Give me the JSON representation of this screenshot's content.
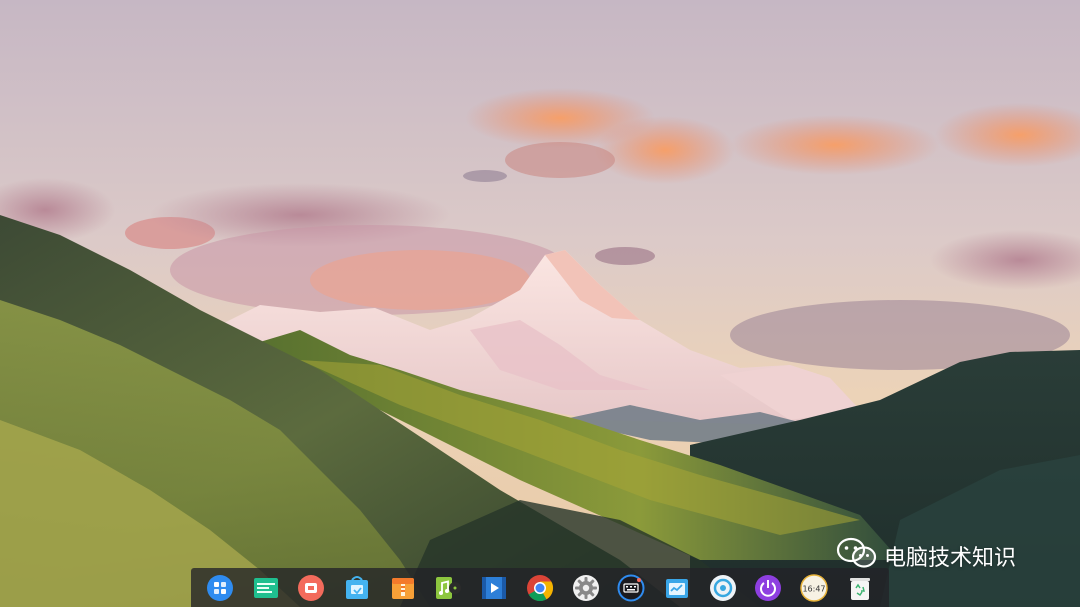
{
  "desktop": {
    "wallpaper": "mountain-landscape",
    "colors": {
      "dock_bg": "#232328",
      "sky_top": "#c9b9c3",
      "sky_bottom": "#efd6b0"
    }
  },
  "watermark": {
    "icon": "wechat-icon",
    "text": "电脑技术知识"
  },
  "dock": {
    "items": [
      {
        "name": "launcher",
        "icon": "launcher-icon"
      },
      {
        "name": "file-manager",
        "icon": "folder-icon"
      },
      {
        "name": "screen-recorder",
        "icon": "screen-recorder-icon"
      },
      {
        "name": "app-store",
        "icon": "app-store-icon"
      },
      {
        "name": "archive-manager",
        "icon": "archive-icon"
      },
      {
        "name": "music",
        "icon": "music-icon"
      },
      {
        "name": "video-player",
        "icon": "video-icon"
      },
      {
        "name": "chrome",
        "icon": "chrome-icon"
      },
      {
        "name": "settings",
        "icon": "gear-icon"
      },
      {
        "name": "input-method",
        "icon": "keyboard-icon"
      },
      {
        "name": "system-monitor",
        "icon": "monitor-icon"
      },
      {
        "name": "screenshot",
        "icon": "camera-icon"
      },
      {
        "name": "power",
        "icon": "power-icon"
      },
      {
        "name": "clock",
        "icon": "clock-icon",
        "label": "16:47"
      },
      {
        "name": "trash",
        "icon": "trash-icon"
      }
    ]
  }
}
